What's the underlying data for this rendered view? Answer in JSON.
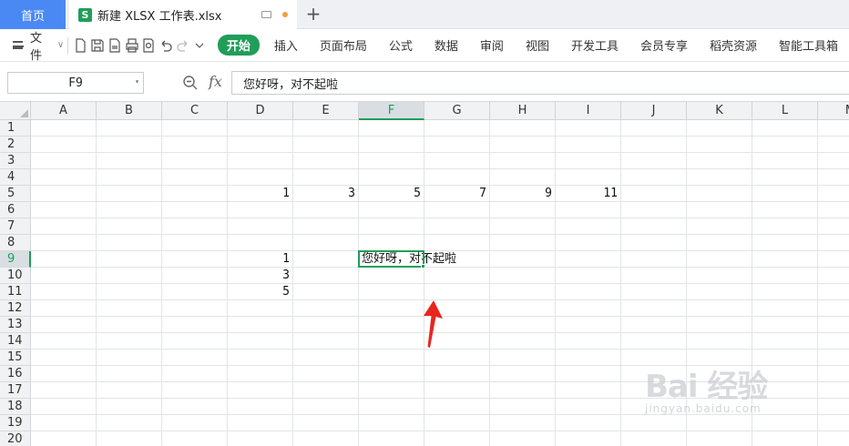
{
  "tabs": {
    "home_label": "首页",
    "doc_icon_letter": "S",
    "doc_title": "新建 XLSX 工作表.xlsx",
    "add_tab": "+"
  },
  "ribbon": {
    "file_label": "文件",
    "file_chevron": "∨",
    "menu": [
      "开始",
      "插入",
      "页面布局",
      "公式",
      "数据",
      "审阅",
      "视图",
      "开发工具",
      "会员专享",
      "稻壳资源",
      "智能工具箱"
    ],
    "active_index": 0
  },
  "formula_bar": {
    "name_box": "F9",
    "fx": "fx",
    "content": "您好呀，对不起啦"
  },
  "columns": [
    "A",
    "B",
    "C",
    "D",
    "E",
    "F",
    "G",
    "H",
    "I",
    "J",
    "K",
    "L",
    "M"
  ],
  "rows": [
    "1",
    "2",
    "3",
    "4",
    "5",
    "6",
    "7",
    "8",
    "9",
    "10",
    "11",
    "12",
    "13",
    "14",
    "15",
    "16",
    "17",
    "18",
    "19",
    "20"
  ],
  "selected_col": "F",
  "selected_row": "9",
  "cells": [
    {
      "ref": "D5",
      "value": "1"
    },
    {
      "ref": "E5",
      "value": "3"
    },
    {
      "ref": "F5",
      "value": "5"
    },
    {
      "ref": "G5",
      "value": "7"
    },
    {
      "ref": "H5",
      "value": "9"
    },
    {
      "ref": "I5",
      "value": "11"
    },
    {
      "ref": "D9",
      "value": "1"
    },
    {
      "ref": "F9",
      "value": "您好呀，对不起啦",
      "text": true
    },
    {
      "ref": "D10",
      "value": "3"
    },
    {
      "ref": "D11",
      "value": "5"
    }
  ],
  "colors": {
    "accent": "#1f9e5a",
    "home_tab": "#4a89f3",
    "arrow": "#e8261f"
  },
  "watermark": {
    "main": "Bai 经验",
    "sub": "jingyan.baidu.com"
  }
}
